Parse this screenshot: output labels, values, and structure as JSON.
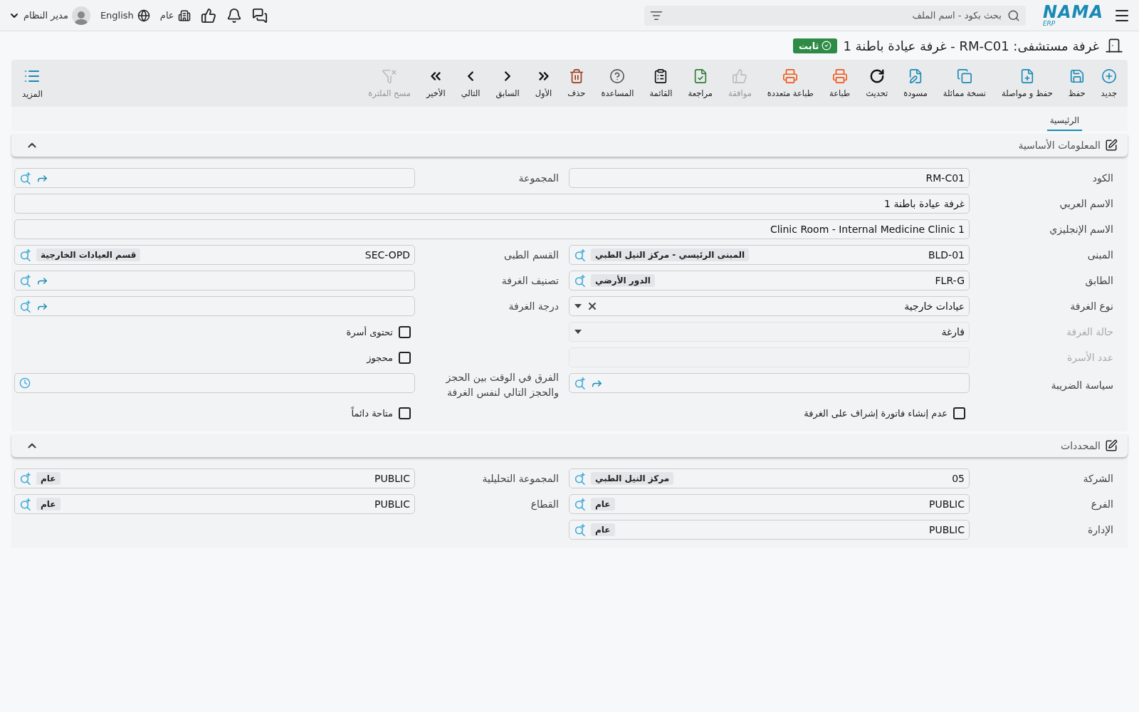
{
  "topbar": {
    "logo": {
      "name": "NAMA",
      "sub": "ERP"
    },
    "search": {
      "placeholder": "بحث بكود - اسم الملف"
    },
    "company": "عام",
    "language": "English",
    "user": "مدير النظام"
  },
  "title": {
    "text": "غرفة مستشفى: RM-C01 - غرفة عيادة باطنة 1",
    "status": "ثابت"
  },
  "toolbar": [
    {
      "kind": "new",
      "label": "جديد",
      "color": "#1a8ab5",
      "disabled": false
    },
    {
      "kind": "save",
      "label": "حفظ",
      "color": "#1a8ab5",
      "disabled": false
    },
    {
      "kind": "savecontinue",
      "label": "حفظ و مواصلة",
      "color": "#1a8ab5",
      "disabled": false
    },
    {
      "kind": "duplicate",
      "label": "نسخة مماثلة",
      "color": "#1a8ab5",
      "disabled": false
    },
    {
      "kind": "draft",
      "label": "مسودة",
      "color": "#1a8ab5",
      "disabled": false
    },
    {
      "kind": "refresh",
      "label": "تحديث",
      "color": "#111111",
      "disabled": false
    },
    {
      "kind": "print",
      "label": "طباعة",
      "color": "#f05a1a",
      "disabled": false
    },
    {
      "kind": "multiprint",
      "label": "طباعة متعددة",
      "color": "#f05a1a",
      "disabled": false
    },
    {
      "kind": "approve",
      "label": "موافقة",
      "color": "#b5b5b5",
      "disabled": true
    },
    {
      "kind": "review",
      "label": "مراجعة",
      "color": "#2e7d32",
      "disabled": false
    },
    {
      "kind": "list",
      "label": "القائمة",
      "color": "#111111",
      "disabled": false
    },
    {
      "kind": "help",
      "label": "المساعدة",
      "color": "#555555",
      "disabled": false
    },
    {
      "kind": "delete",
      "label": "حذف",
      "color": "#9c3a1a",
      "disabled": false
    },
    {
      "kind": "first",
      "label": "الأول",
      "color": "#111111",
      "disabled": false
    },
    {
      "kind": "previous",
      "label": "السابق",
      "color": "#111111",
      "disabled": false
    },
    {
      "kind": "next",
      "label": "التالي",
      "color": "#111111",
      "disabled": false
    },
    {
      "kind": "last",
      "label": "الأخير",
      "color": "#111111",
      "disabled": false
    },
    {
      "kind": "clearfilter",
      "label": "مسح الفلترة",
      "color": "#b5b5b5",
      "disabled": true
    }
  ],
  "more": {
    "label": "المزيد"
  },
  "tabs": [
    {
      "label": "الرئيسية",
      "selected": true
    }
  ],
  "sections": [
    {
      "title": "المعلومات الأساسية",
      "expanded": true,
      "rows": [
        {
          "kind": "pair",
          "fields": [
            {
              "kind": "text",
              "label": "الكود",
              "value": "RM-C01",
              "disabled": false
            },
            {
              "kind": "lookup",
              "label": "المجموعة"
            }
          ]
        },
        {
          "kind": "full",
          "fields": [
            {
              "kind": "text",
              "label": "الاسم العربي",
              "value": "غرفة عيادة باطنة 1",
              "disabled": false
            }
          ]
        },
        {
          "kind": "full",
          "fields": [
            {
              "kind": "text",
              "label": "الاسم الإنجليزي",
              "value": "Clinic Room - Internal Medicine Clinic 1",
              "disabled": false
            }
          ]
        },
        {
          "kind": "pair",
          "fields": [
            {
              "kind": "lookup",
              "label": "المبنى",
              "value": "BLD-01",
              "tag": "المبنى الرئيسي - مركز النيل الطبي"
            },
            {
              "kind": "lookup",
              "label": "القسم الطبى",
              "value": "SEC-OPD",
              "tag": "قسم العيادات الخارجية"
            }
          ]
        },
        {
          "kind": "pair",
          "fields": [
            {
              "kind": "lookup",
              "label": "الطابق",
              "value": "FLR-G",
              "tag": "الدور الأرضي"
            },
            {
              "kind": "lookup",
              "label": "تصنيف الغرفة"
            }
          ]
        },
        {
          "kind": "pair",
          "fields": [
            {
              "kind": "select",
              "label": "نوع الغرفة",
              "value": "عيادات خارجية",
              "clearable": true,
              "disabled": false
            },
            {
              "kind": "lookup",
              "label": "درجة الغرفة"
            }
          ]
        },
        {
          "kind": "pair",
          "fields": [
            {
              "kind": "select",
              "label": "حالة الغرفة",
              "value": "فارغة",
              "clearable": false,
              "disabled": true
            },
            {
              "kind": "checkbox",
              "label": "تحتوى أسرة",
              "checked": false
            }
          ]
        },
        {
          "kind": "pair",
          "fields": [
            {
              "kind": "text",
              "label": "عدد الأسرة",
              "disabled": true
            },
            {
              "kind": "checkbox",
              "label": "محجوز",
              "checked": false
            }
          ]
        },
        {
          "kind": "pair",
          "fields": [
            {
              "kind": "lookup",
              "label": "سياسة الضريبة"
            },
            {
              "kind": "time",
              "label": "الفرق في الوقت بين الحجز والحجز التالي لنفس الغرفة"
            }
          ]
        },
        {
          "kind": "pair",
          "fields": [
            {
              "kind": "checkbox",
              "label": "عدم إنشاء فاتورة إشراف على الغرفة",
              "checked": false
            },
            {
              "kind": "checkbox",
              "label": "متاحة دائماً",
              "checked": false
            }
          ]
        }
      ]
    },
    {
      "title": "المحددات",
      "expanded": true,
      "rows": [
        {
          "kind": "pair",
          "fields": [
            {
              "kind": "lookup",
              "label": "الشركة",
              "value": "05",
              "tag": "مركز النيل الطبي"
            },
            {
              "kind": "lookup",
              "label": "المجموعة التحليلية",
              "value": "PUBLIC",
              "tag": "عام"
            }
          ]
        },
        {
          "kind": "pair",
          "fields": [
            {
              "kind": "lookup",
              "label": "الفرع",
              "value": "PUBLIC",
              "tag": "عام"
            },
            {
              "kind": "lookup",
              "label": "القطاع",
              "value": "PUBLIC",
              "tag": "عام"
            }
          ]
        },
        {
          "kind": "pair",
          "fields": [
            {
              "kind": "lookup",
              "label": "الإدارة",
              "value": "PUBLIC",
              "tag": "عام"
            }
          ]
        }
      ]
    }
  ]
}
